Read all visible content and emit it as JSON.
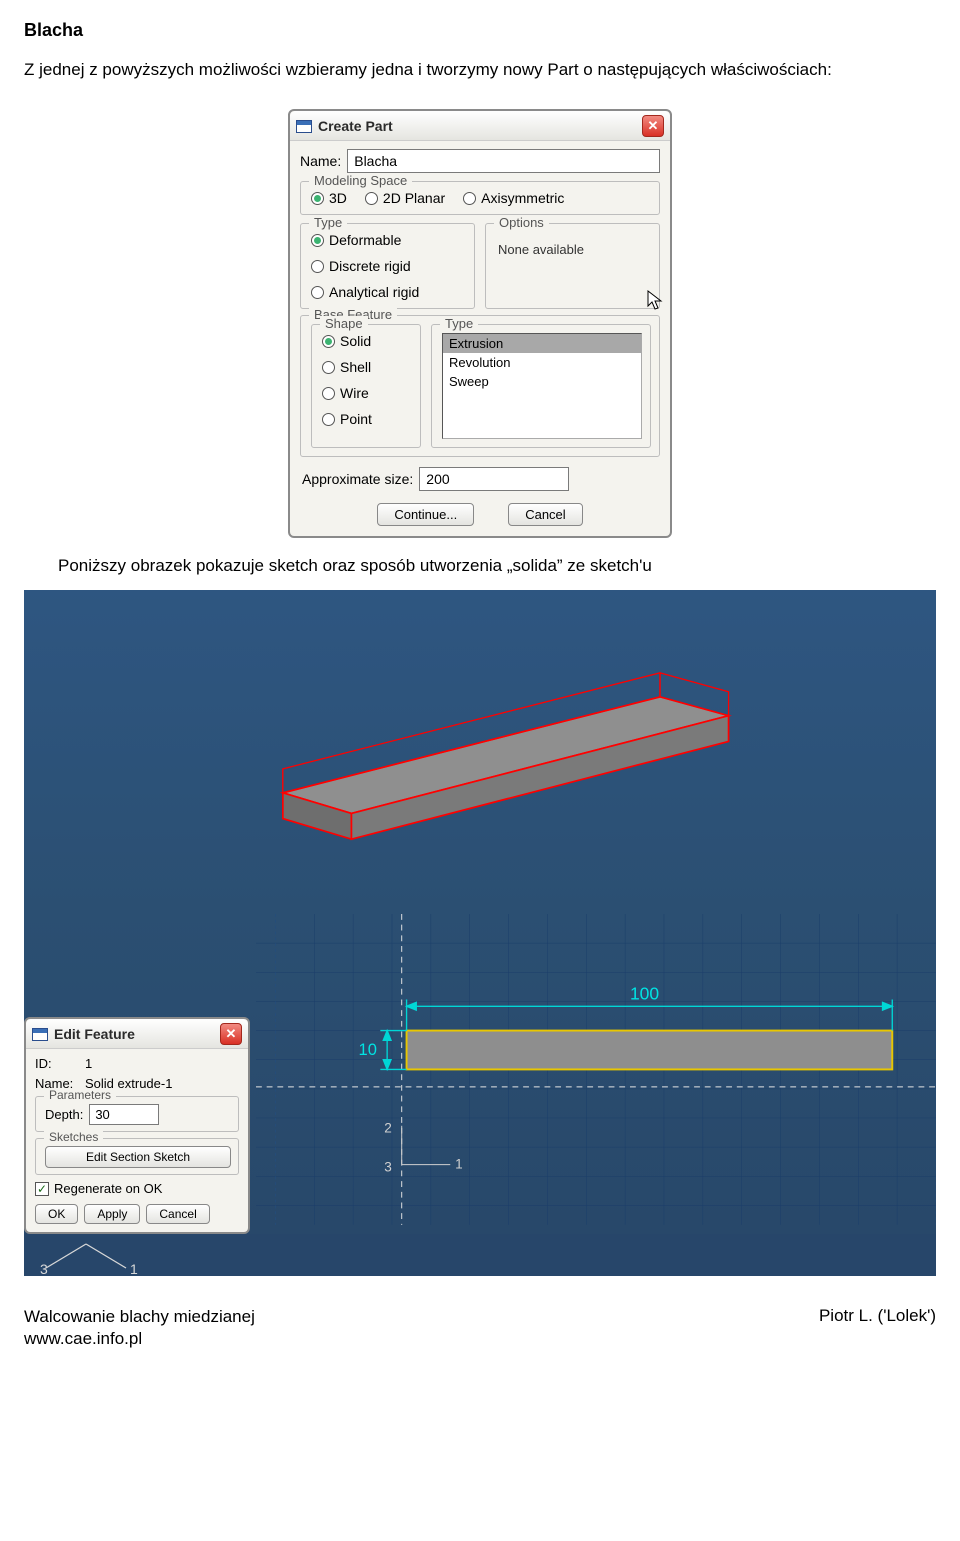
{
  "doc": {
    "title": "Blacha",
    "para1": "Z jednej  z powyższych możliwości wzbieramy jedna i tworzymy nowy Part o następujących właściwościach:",
    "para2": "Poniższy obrazek pokazuje sketch oraz sposób  utworzenia „solida” ze sketch'u"
  },
  "create_part": {
    "title": "Create Part",
    "name_label": "Name:",
    "name_value": "Blacha",
    "modeling_space": {
      "legend": "Modeling Space",
      "options": [
        "3D",
        "2D Planar",
        "Axisymmetric"
      ],
      "selected": "3D"
    },
    "type": {
      "legend": "Type",
      "options": [
        "Deformable",
        "Discrete rigid",
        "Analytical rigid"
      ],
      "selected": "Deformable"
    },
    "options": {
      "legend": "Options",
      "text": "None available"
    },
    "base_feature": {
      "legend": "Base Feature",
      "shape": {
        "legend": "Shape",
        "options": [
          "Solid",
          "Shell",
          "Wire",
          "Point"
        ],
        "selected": "Solid"
      },
      "type": {
        "legend": "Type",
        "options": [
          "Extrusion",
          "Revolution",
          "Sweep"
        ],
        "selected": "Extrusion"
      }
    },
    "approx_label": "Approximate size:",
    "approx_value": "200",
    "continue_btn": "Continue...",
    "cancel_btn": "Cancel"
  },
  "edit_feature": {
    "title": "Edit Feature",
    "id_label": "ID:",
    "id_value": "1",
    "name_label": "Name:",
    "name_value": "Solid extrude-1",
    "params_legend": "Parameters",
    "depth_label": "Depth:",
    "depth_value": "30",
    "sketches_legend": "Sketches",
    "edit_sketch_btn": "Edit Section Sketch",
    "regen_label": "Regenerate on OK",
    "ok_btn": "OK",
    "apply_btn": "Apply",
    "cancel_btn": "Cancel"
  },
  "sketch": {
    "dim_w": "100",
    "dim_h": "10",
    "axis_tick_2": "2",
    "axis_tick_3": "3",
    "axis_tick_1": "1",
    "triad_3": "3",
    "triad_1": "1"
  },
  "footer": {
    "left1": "Walcowanie blachy miedzianej",
    "left2": "www.cae.info.pl",
    "right": "Piotr L. ('Lolek')"
  }
}
